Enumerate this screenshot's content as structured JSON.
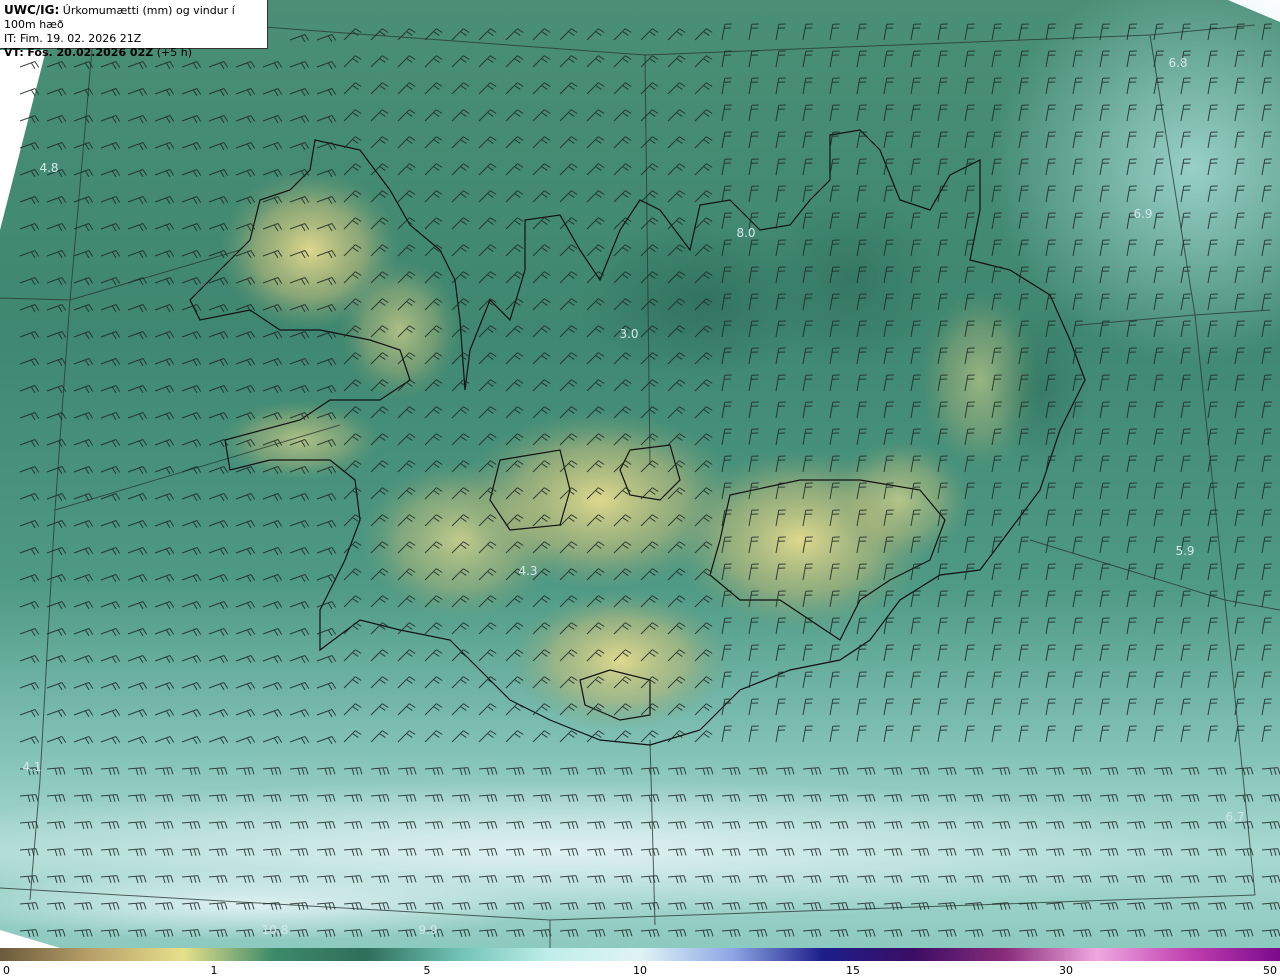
{
  "header": {
    "product": "UWC/IG:",
    "description": "Úrkomumætti (mm) og vindur í 100m hæð",
    "init_time": "IT: Fim. 19. 02. 2026 21Z",
    "valid_prefix": "VT:",
    "valid_time": "Fös. 20.02.2026 02Z",
    "lead": "(+5 h)"
  },
  "map_labels": [
    {
      "text": "6.8"
    },
    {
      "text": "4.8"
    },
    {
      "text": "6.9"
    },
    {
      "text": "8.0"
    },
    {
      "text": "3.0"
    },
    {
      "text": "4.3"
    },
    {
      "text": "5.9"
    },
    {
      "text": "4.1"
    },
    {
      "text": "6.7"
    },
    {
      "text": "9.9"
    },
    {
      "text": "10.8"
    }
  ],
  "colorbar": {
    "ticks": [
      "0",
      "1",
      "5",
      "10",
      "15",
      "30",
      "50"
    ],
    "colors": [
      "#6b5a3c",
      "#b7a06a",
      "#e6e08a",
      "#3c8a6a",
      "#2f6e5a",
      "#6fc1b4",
      "#bfeeea",
      "#dff4f4",
      "#8fa8e6",
      "#1c1e8a",
      "#3b0d64",
      "#8a2d7a",
      "#f0a8e0",
      "#c040b0",
      "#7a0a8a"
    ]
  }
}
